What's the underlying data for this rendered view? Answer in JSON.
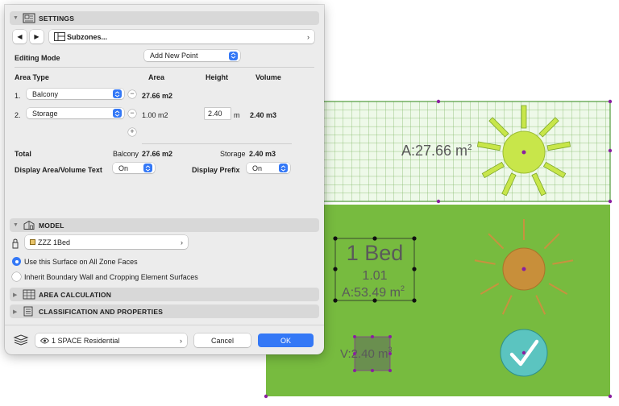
{
  "settings": {
    "title": "SETTINGS",
    "nav_prev": "◀",
    "nav_next": "▶",
    "subzones_label": "Subzones...",
    "editing_mode_label": "Editing Mode",
    "editing_mode_value": "Add New Point",
    "columns": {
      "area_type": "Area Type",
      "area": "Area",
      "height": "Height",
      "volume": "Volume"
    },
    "rows": [
      {
        "index": "1.",
        "type": "Balcony",
        "area": "27.66 m2",
        "height": "",
        "height_unit": "",
        "volume": ""
      },
      {
        "index": "2.",
        "type": "Storage",
        "area": "1.00 m2",
        "height": "2.40",
        "height_unit": "m",
        "volume": "2.40 m3"
      }
    ],
    "add_label": "+",
    "minus_label": "−",
    "total_label": "Total",
    "total_balcony_label": "Balcony",
    "total_balcony_value": "27.66 m2",
    "total_storage_label": "Storage",
    "total_storage_value": "2.40 m3",
    "display_text_label": "Display Area/Volume Text",
    "display_text_value": "On",
    "display_prefix_label": "Display Prefix",
    "display_prefix_value": "On"
  },
  "model": {
    "title": "MODEL",
    "surface_value": "ZZZ 1Bed",
    "radio_options": [
      {
        "label": "Use this Surface on All Zone Faces",
        "selected": true
      },
      {
        "label": "Inherit Boundary Wall and Cropping Element Surfaces",
        "selected": false
      }
    ]
  },
  "area_calculation": {
    "title": "AREA CALCULATION"
  },
  "classification": {
    "title": "CLASSIFICATION AND PROPERTIES"
  },
  "footer": {
    "layer_value": "1 SPACE Residential",
    "cancel_label": "Cancel",
    "ok_label": "OK"
  },
  "canvas": {
    "balcony_area_text": "A:27.66 m",
    "balcony_area_sup": "2",
    "zone_name": "1 Bed",
    "zone_number": "1.01",
    "zone_area_text": "A:53.49 m",
    "zone_area_sup": "2",
    "storage_volume_text": "V:2.40 m",
    "storage_volume_sup": "3"
  },
  "colors": {
    "accent": "#3478f6",
    "zone_green": "#77bb3f",
    "balcony_green": "#e9f7e3",
    "balcony_grid": "#6faa55",
    "handle": "#8a1fa0",
    "sun_yellow": "#c8e64a",
    "sun_orange": "#c88f3a",
    "check_teal": "#5bc4c0"
  }
}
